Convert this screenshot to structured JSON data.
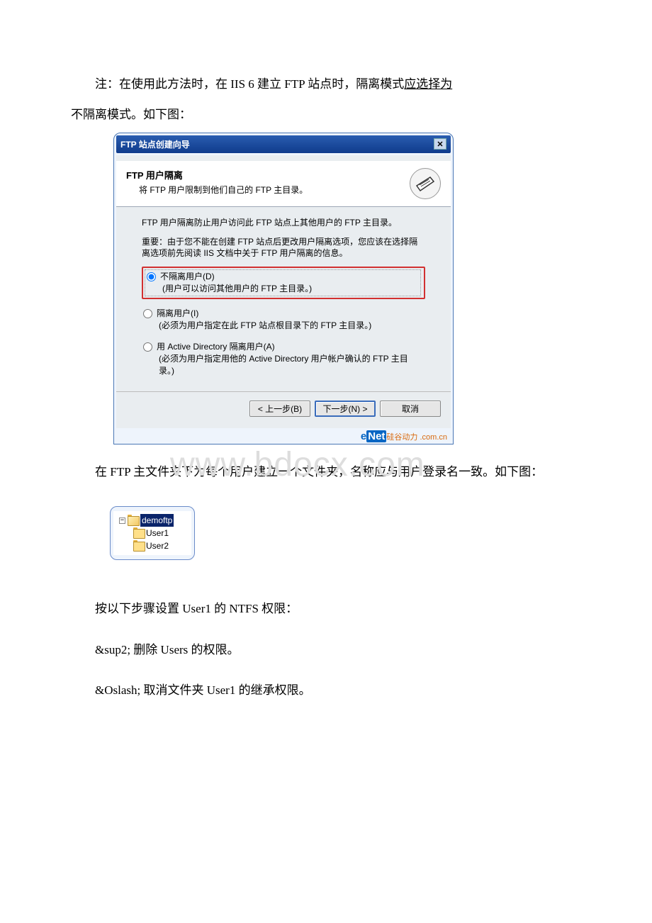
{
  "intro": {
    "line1": "注：在使用此方法时，在 IIS 6 建立 FTP 站点时，隔离模式",
    "line1_underline": "应选择为",
    "line2": "不隔离模式。如下图："
  },
  "dialog": {
    "title": "FTP 站点创建向导",
    "header_title": "FTP 用户隔离",
    "header_sub": "将 FTP 用户限制到他们自己的 FTP 主目录。",
    "info1": "FTP 用户隔离防止用户访问此 FTP 站点上其他用户的 FTP 主目录。",
    "info2": "重要：由于您不能在创建 FTP 站点后更改用户隔离选项，您应该在选择隔离选项前先阅读 IIS 文档中关于 FTP 用户隔离的信息。",
    "radio1_main": "不隔离用户(D)",
    "radio1_sub": "(用户可以访问其他用户的 FTP 主目录。)",
    "radio2_main": "隔离用户(I)",
    "radio2_sub": "(必须为用户指定在此 FTP 站点根目录下的 FTP 主目录。)",
    "radio3_main": "用 Active Directory 隔离用户(A)",
    "radio3_sub": "(必须为用户指定用他的 Active Directory 用户帐户确认的 FTP 主目录。)",
    "btn_prev": "< 上一步(B)",
    "btn_next": "下一步(N) >",
    "btn_cancel": "取消",
    "enet_e": "e",
    "enet_net": "Net",
    "enet_cn": "硅谷动力 .com.cn"
  },
  "paragraphs": {
    "p1": "在 FTP 主文件夹下为每个用户建立一个文件夹，名称应与用户登录名一致。如下图：",
    "p2": "按以下步骤设置 User1 的 NTFS 权限：",
    "p3": "&sup2; 删除 Users 的权限。",
    "p4": "&Oslash; 取消文件夹 User1 的继承权限。"
  },
  "watermark": "www.bdocx.com",
  "tree": {
    "root": "demoftp",
    "child1": "User1",
    "child2": "User2"
  }
}
